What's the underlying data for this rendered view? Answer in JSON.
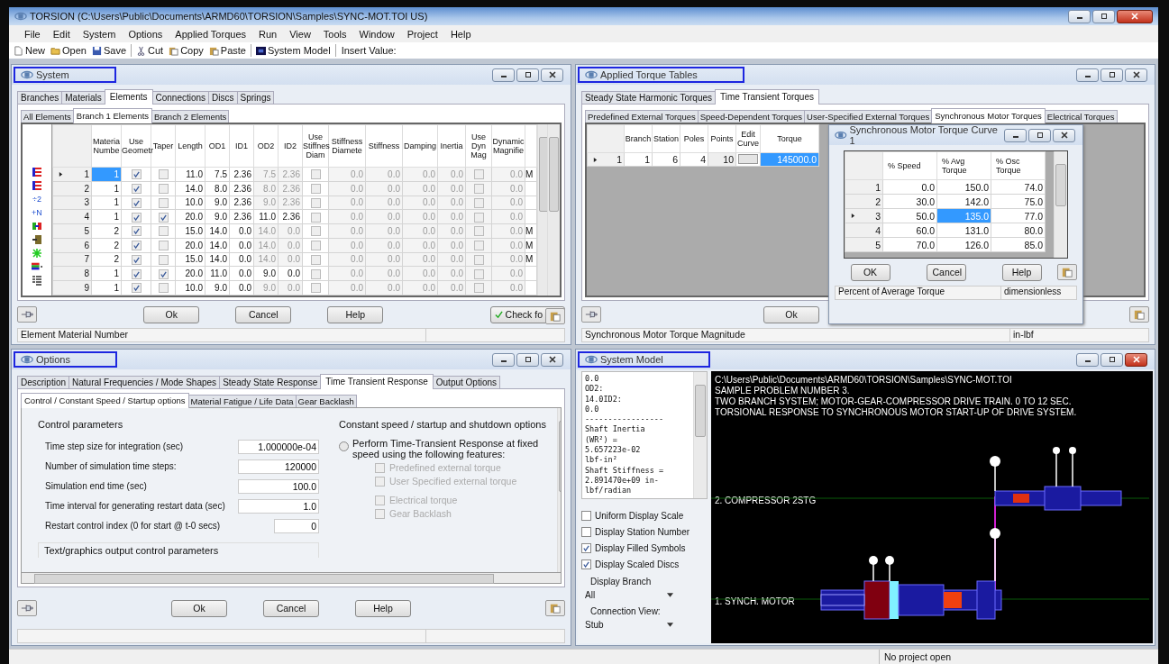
{
  "window": {
    "title": "TORSION (C:\\Users\\Public\\Documents\\ARMD60\\TORSION\\Samples\\SYNC-MOT.TOI US)"
  },
  "menu": [
    "File",
    "Edit",
    "System",
    "Options",
    "Applied Torques",
    "Run",
    "View",
    "Tools",
    "Window",
    "Project",
    "Help"
  ],
  "toolbar": [
    {
      "kind": "new",
      "label": "New"
    },
    {
      "kind": "open",
      "label": "Open"
    },
    {
      "kind": "save",
      "label": "Save"
    },
    {
      "kind": "sep"
    },
    {
      "kind": "cut",
      "label": "Cut"
    },
    {
      "kind": "copy",
      "label": "Copy"
    },
    {
      "kind": "paste",
      "label": "Paste"
    },
    {
      "kind": "sep"
    },
    {
      "kind": "model",
      "label": "System Model"
    },
    {
      "kind": "sep"
    },
    {
      "kind": "label",
      "label": "Insert Value:"
    }
  ],
  "system_panel": {
    "title": "System",
    "tabs": [
      {
        "label": "Branches",
        "selected": false
      },
      {
        "label": "Materials",
        "selected": false
      },
      {
        "label": "Elements",
        "selected": true
      },
      {
        "label": "Connections",
        "selected": false
      },
      {
        "label": "Discs",
        "selected": false
      },
      {
        "label": "Springs",
        "selected": false
      }
    ],
    "subtabs": [
      {
        "label": "All Elements",
        "selected": false
      },
      {
        "label": "Branch 1 Elements",
        "selected": true
      },
      {
        "label": "Branch 2 Elements",
        "selected": false
      }
    ],
    "tools": [
      {
        "kind": "flag"
      },
      {
        "kind": "flag"
      },
      {
        "kind": "glyph",
        "label": "÷2"
      },
      {
        "kind": "glyph",
        "label": "+N"
      },
      {
        "kind": "split"
      },
      {
        "kind": "door"
      },
      {
        "kind": "star"
      },
      {
        "kind": "colorbar"
      },
      {
        "kind": "list"
      }
    ],
    "columns": [
      "Materia Numbe",
      "Use Geometr",
      "Taper",
      "Length",
      "OD1",
      "ID1",
      "OD2",
      "ID2",
      "Use Stiffnes Diam",
      "Stiffness Diamete",
      "Stiffness",
      "Damping",
      "Inertia",
      "Use Dyn Mag",
      "Dynamic Magnifie"
    ],
    "rows": [
      {
        "number": "1",
        "selected": true,
        "material": "1",
        "use_geometry": true,
        "taper": false,
        "length": "11.0",
        "od1": "7.5",
        "id1": "2.36",
        "od2": "7.5",
        "id2": "2.36",
        "use_stiffness_diam": false,
        "stiffness_diameter": "0.0",
        "stiffness": "0.0",
        "damping": "0.0",
        "inertia": "0.0",
        "use_dyn_mag": false,
        "dynamic_magnifier": "0.0",
        "column_17": "M"
      },
      {
        "number": "2",
        "selected": false,
        "material": "1",
        "use_geometry": true,
        "taper": false,
        "length": "14.0",
        "od1": "8.0",
        "id1": "2.36",
        "od2": "8.0",
        "id2": "2.36",
        "use_stiffness_diam": false,
        "stiffness_diameter": "0.0",
        "stiffness": "0.0",
        "damping": "0.0",
        "inertia": "0.0",
        "use_dyn_mag": false,
        "dynamic_magnifier": "0.0"
      },
      {
        "number": "3",
        "selected": false,
        "material": "1",
        "use_geometry": true,
        "taper": false,
        "length": "10.0",
        "od1": "9.0",
        "id1": "2.36",
        "od2": "9.0",
        "id2": "2.36",
        "use_stiffness_diam": false,
        "stiffness_diameter": "0.0",
        "stiffness": "0.0",
        "damping": "0.0",
        "inertia": "0.0",
        "use_dyn_mag": false,
        "dynamic_magnifier": "0.0"
      },
      {
        "number": "4",
        "selected": false,
        "material": "1",
        "use_geometry": true,
        "taper": true,
        "length": "20.0",
        "od1": "9.0",
        "id1": "2.36",
        "od2": "11.0",
        "id2": "2.36",
        "use_stiffness_diam": false,
        "stiffness_diameter": "0.0",
        "stiffness": "0.0",
        "damping": "0.0",
        "inertia": "0.0",
        "use_dyn_mag": false,
        "dynamic_magnifier": "0.0"
      },
      {
        "number": "5",
        "selected": false,
        "material": "2",
        "use_geometry": true,
        "taper": false,
        "length": "15.0",
        "od1": "14.0",
        "id1": "0.0",
        "od2": "14.0",
        "id2": "0.0",
        "use_stiffness_diam": false,
        "stiffness_diameter": "0.0",
        "stiffness": "0.0",
        "damping": "0.0",
        "inertia": "0.0",
        "use_dyn_mag": false,
        "dynamic_magnifier": "0.0",
        "column_17": "M"
      },
      {
        "number": "6",
        "selected": false,
        "material": "2",
        "use_geometry": true,
        "taper": false,
        "length": "20.0",
        "od1": "14.0",
        "id1": "0.0",
        "od2": "14.0",
        "id2": "0.0",
        "use_stiffness_diam": false,
        "stiffness_diameter": "0.0",
        "stiffness": "0.0",
        "damping": "0.0",
        "inertia": "0.0",
        "use_dyn_mag": false,
        "dynamic_magnifier": "0.0",
        "column_17": "M"
      },
      {
        "number": "7",
        "selected": false,
        "material": "2",
        "use_geometry": true,
        "taper": false,
        "length": "15.0",
        "od1": "14.0",
        "id1": "0.0",
        "od2": "14.0",
        "id2": "0.0",
        "use_stiffness_diam": false,
        "stiffness_diameter": "0.0",
        "stiffness": "0.0",
        "damping": "0.0",
        "inertia": "0.0",
        "use_dyn_mag": false,
        "dynamic_magnifier": "0.0",
        "column_17": "M"
      },
      {
        "number": "8",
        "selected": false,
        "material": "1",
        "use_geometry": true,
        "taper": true,
        "length": "20.0",
        "od1": "11.0",
        "id1": "0.0",
        "od2": "9.0",
        "id2": "0.0",
        "use_stiffness_diam": false,
        "stiffness_diameter": "0.0",
        "stiffness": "0.0",
        "damping": "0.0",
        "inertia": "0.0",
        "use_dyn_mag": false,
        "dynamic_magnifier": "0.0"
      },
      {
        "number": "9",
        "selected": false,
        "material": "1",
        "use_geometry": true,
        "taper": false,
        "length": "10.0",
        "od1": "9.0",
        "id1": "0.0",
        "od2": "9.0",
        "id2": "0.0",
        "use_stiffness_diam": false,
        "stiffness_diameter": "0.0",
        "stiffness": "0.0",
        "damping": "0.0",
        "inertia": "0.0",
        "use_dyn_mag": false,
        "dynamic_magnifier": "0.0"
      }
    ],
    "buttons": [
      "Ok",
      "Cancel",
      "Help"
    ],
    "check_button": "Check fo",
    "status": "Element Material Number"
  },
  "torque_panel": {
    "title": "Applied Torque Tables",
    "tabs": [
      {
        "label": "Steady State Harmonic Torques",
        "selected": false
      },
      {
        "label": "Time Transient Torques",
        "selected": true
      }
    ],
    "subtabs": [
      {
        "label": "Predefined External Torques",
        "selected": false
      },
      {
        "label": "Speed-Dependent Torques",
        "selected": false
      },
      {
        "label": "User-Specified External Torques",
        "selected": false
      },
      {
        "label": "Synchronous Motor Torques",
        "selected": true
      },
      {
        "label": "Electrical Torques",
        "selected": false
      }
    ],
    "columns": [
      "Branch",
      "Station",
      "Poles",
      "Points",
      "Edit Curve",
      "Torque"
    ],
    "rows": [
      {
        "number": "1",
        "selected": true,
        "branch": "1",
        "station": "6",
        "poles": "4",
        "points": "10",
        "torque": "145000.0"
      }
    ],
    "button": "Ok",
    "status": "Synchronous Motor Torque Magnitude",
    "units": "in-lbf"
  },
  "curve_dialog": {
    "title": "Synchronous Motor Torque Curve 1",
    "columns": [
      "% Speed",
      "% Avg Torque",
      "% Osc Torque"
    ],
    "rows": [
      {
        "number": "1",
        "selected": false,
        "speed": "0.0",
        "avg": "150.0",
        "osc": "74.0"
      },
      {
        "number": "2",
        "selected": false,
        "speed": "30.0",
        "avg": "142.0",
        "osc": "75.0"
      },
      {
        "number": "3",
        "selected": true,
        "speed": "50.0",
        "avg": "135.0",
        "osc": "77.0"
      },
      {
        "number": "4",
        "selected": false,
        "speed": "60.0",
        "avg": "131.0",
        "osc": "80.0"
      },
      {
        "number": "5",
        "selected": false,
        "speed": "70.0",
        "avg": "126.0",
        "osc": "85.0"
      }
    ],
    "buttons": [
      "OK",
      "Cancel",
      "Help"
    ],
    "status": "Percent of Average Torque",
    "units": "dimensionless"
  },
  "options_panel": {
    "title": "Options",
    "tabs": [
      {
        "label": "Description",
        "selected": false
      },
      {
        "label": "Natural Frequencies / Mode Shapes",
        "selected": false
      },
      {
        "label": "Steady State Response",
        "selected": false
      },
      {
        "label": "Time Transient Response",
        "selected": true
      },
      {
        "label": "Output Options",
        "selected": false
      }
    ],
    "subtabs": [
      {
        "label": "Control / Constant Speed / Startup options",
        "selected": true
      },
      {
        "label": "Material Fatigue / Life Data",
        "selected": false
      },
      {
        "label": "Gear Backlash",
        "selected": false
      }
    ],
    "control_group": "Control parameters",
    "fields": [
      {
        "label": "Time step size for integration (sec)",
        "value": "1.000000e-04"
      },
      {
        "label": "Number of simulation time steps:",
        "value": "120000"
      },
      {
        "label": "Simulation end time (sec)",
        "value": "100.0"
      },
      {
        "label": "Time interval for generating restart data (sec)",
        "value": "1.0"
      },
      {
        "label": "Restart control index (0 for start @ t-0 secs)",
        "value": "0",
        "short": true
      }
    ],
    "output_group": "Text/graphics output control parameters",
    "speed_group": "Constant speed / startup and shutdown options",
    "radio": {
      "label": "Perform Time-Transient Response at fixed speed using the following features:",
      "selected": false
    },
    "features": [
      {
        "label": "Predefined external torque",
        "checked": false,
        "disabled": true
      },
      {
        "label": "User Specified external torque",
        "checked": false,
        "disabled": true
      },
      {
        "label": "Electrical torque",
        "checked": false,
        "disabled": true
      },
      {
        "label": "Gear Backlash",
        "checked": false,
        "disabled": true
      }
    ],
    "buttons": [
      "Ok",
      "Cancel",
      "Help"
    ]
  },
  "model_panel": {
    "title": "System Model",
    "info_lines": [
      "0.0",
      "OD2:",
      "14.0ID2:",
      "0.0",
      "-----------------",
      "Shaft Inertia",
      "(WR²) =",
      "5.657223e-02",
      "lbf-in²",
      "Shaft Stiffness =",
      "2.891470e+09 in-",
      "lbf/radian"
    ],
    "checkboxes": [
      {
        "label": "Uniform Display Scale",
        "checked": false
      },
      {
        "label": "Display Station Number",
        "checked": false
      },
      {
        "label": "Display Filled Symbols",
        "checked": true
      },
      {
        "label": "Display Scaled Discs",
        "checked": true
      }
    ],
    "dropdowns": [
      {
        "label": "Display Branch",
        "value": "All"
      },
      {
        "label": "Connection View:",
        "value": "Stub"
      }
    ],
    "canvas_lines": [
      "C:\\Users\\Public\\Documents\\ARMD60\\TORSION\\Samples\\SYNC-MOT.TOI",
      "SAMPLE PROBLEM NUMBER 3.",
      "TWO BRANCH SYSTEM; MOTOR-GEAR-COMPRESSOR DRIVE TRAIN. 0 TO 12 SEC.",
      "TORSIONAL RESPONSE TO SYNCHRONOUS MOTOR START-UP OF DRIVE SYSTEM."
    ],
    "branches": [
      "2. COMPRESSOR 2STG",
      "1. SYNCH. MOTOR"
    ]
  },
  "status_bar": "No project open"
}
